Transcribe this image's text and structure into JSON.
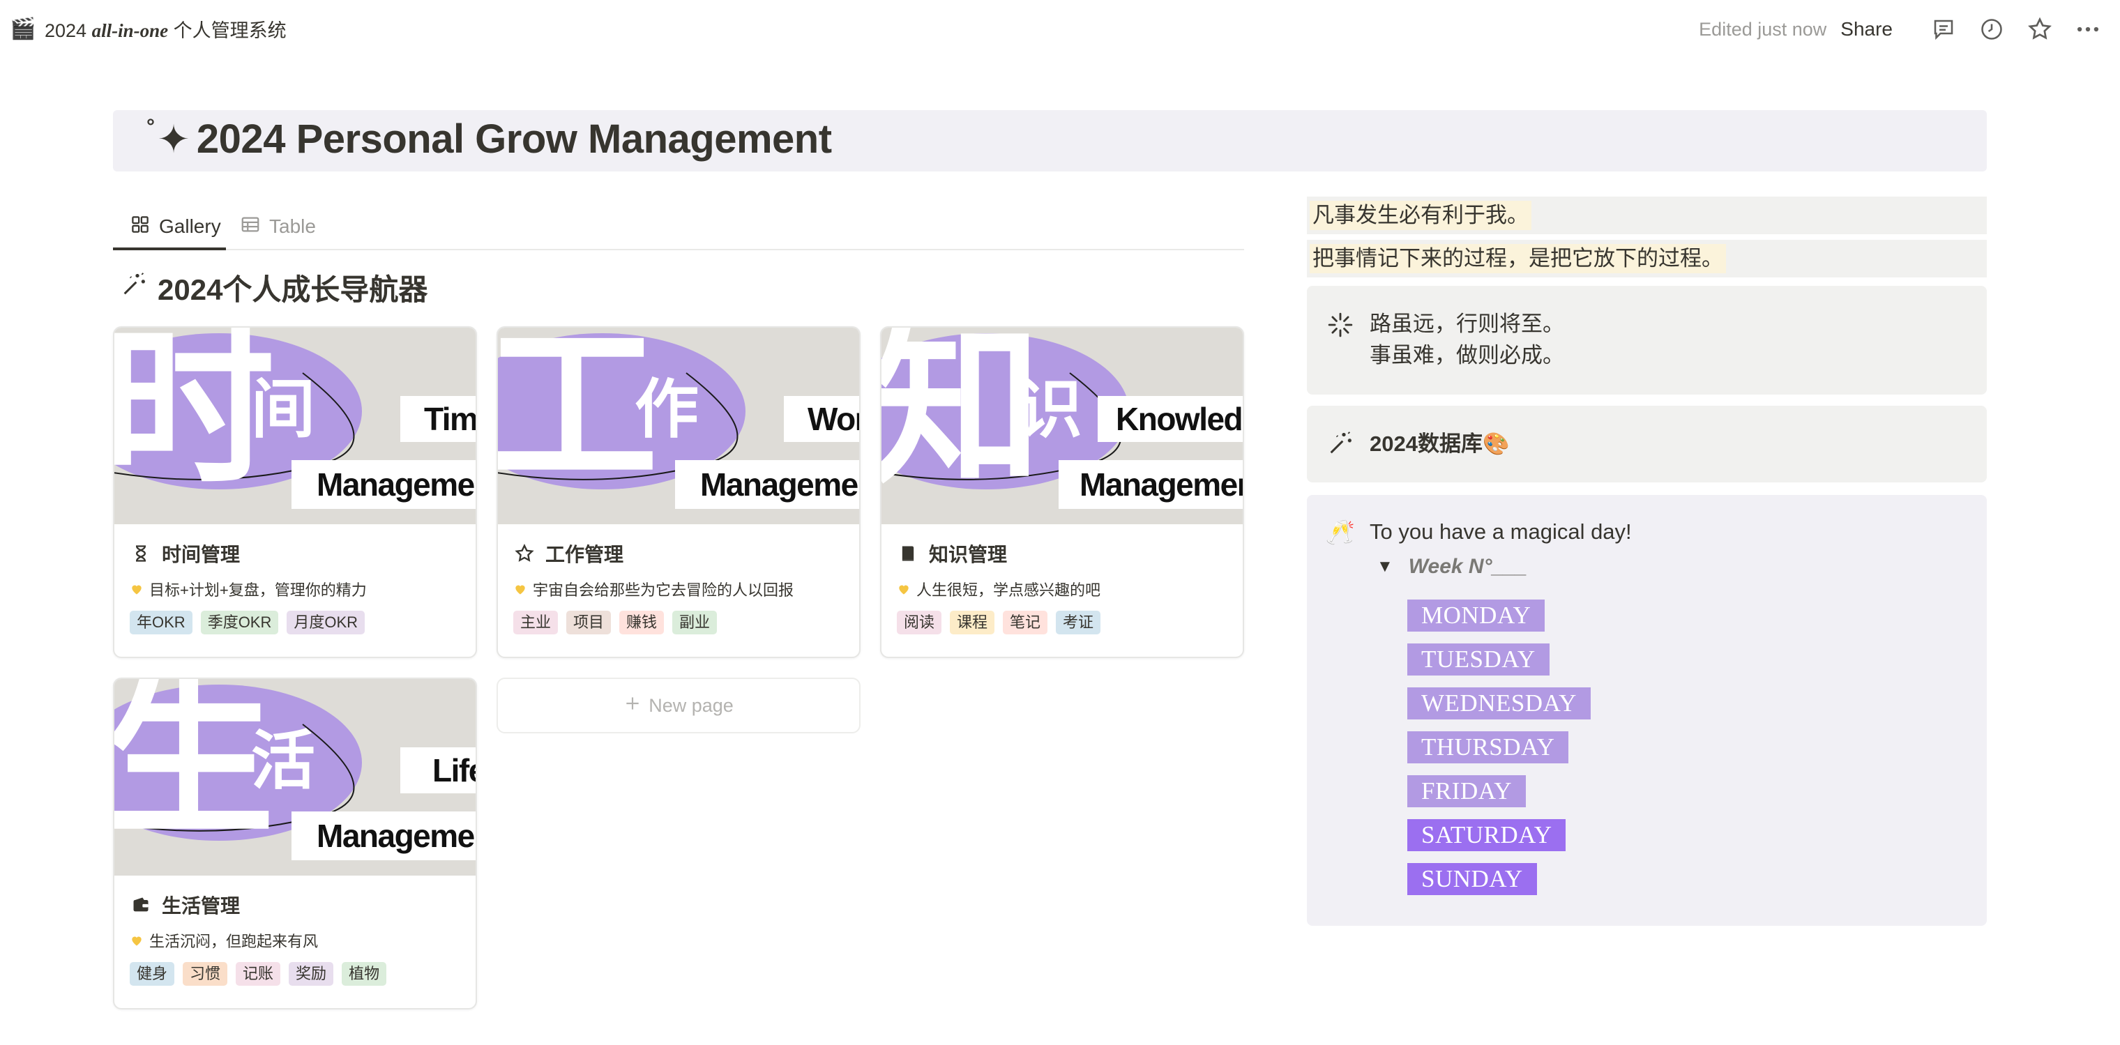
{
  "topbar": {
    "page_icon": "clapperboard-icon",
    "title_prefix": "2024 ",
    "title_italic": "all-in-one",
    "title_suffix": " 个人管理系统",
    "edited": "Edited just now",
    "share": "Share"
  },
  "page": {
    "title_degree": "°",
    "title_sparkle": "✦",
    "title": "2024 Personal Grow Management"
  },
  "tabs": [
    {
      "label": "Gallery",
      "icon": "gallery-icon"
    },
    {
      "label": "Table",
      "icon": "table-icon"
    }
  ],
  "section_title": "2024个人成长导航器",
  "cards": [
    {
      "big": "时",
      "small": "间",
      "line1": "Time",
      "line2": "Management",
      "name": "时间管理",
      "icon": "hourglass-icon",
      "desc": "目标+计划+复盘，管理你的精力",
      "tags": [
        {
          "label": "年OKR",
          "color": "#d3e5ef"
        },
        {
          "label": "季度OKR",
          "color": "#dbeddb"
        },
        {
          "label": "月度OKR",
          "color": "#e8deee"
        }
      ]
    },
    {
      "big": "工",
      "small": "作",
      "line1": "Work",
      "line2": "Management",
      "name": "工作管理",
      "icon": "star-icon",
      "desc": "宇宙自会给那些为它去冒险的人以回报",
      "tags": [
        {
          "label": "主业",
          "color": "#f5e0e9"
        },
        {
          "label": "项目",
          "color": "#eee0da"
        },
        {
          "label": "赚钱",
          "color": "#ffe2dd"
        },
        {
          "label": "副业",
          "color": "#dbeddb"
        }
      ]
    },
    {
      "big": "知",
      "small": "识",
      "line1": "Knowledge",
      "line2": "Management",
      "name": "知识管理",
      "icon": "book-icon",
      "desc": "人生很短，学点感兴趣的吧",
      "tags": [
        {
          "label": "阅读",
          "color": "#f5e0e9"
        },
        {
          "label": "课程",
          "color": "#fdecc8"
        },
        {
          "label": "笔记",
          "color": "#ffe2dd"
        },
        {
          "label": "考证",
          "color": "#d3e5ef"
        }
      ]
    },
    {
      "big": "生",
      "small": "活",
      "line1": "Life",
      "line2": "Management",
      "name": "生活管理",
      "icon": "wallet-icon",
      "desc": "生活沉闷，但跑起来有风",
      "tags": [
        {
          "label": "健身",
          "color": "#d3e5ef"
        },
        {
          "label": "习惯",
          "color": "#fadec9"
        },
        {
          "label": "记账",
          "color": "#f5e0e9"
        },
        {
          "label": "奖励",
          "color": "#e8deee"
        },
        {
          "label": "植物",
          "color": "#dbeddb"
        }
      ]
    }
  ],
  "new_page": "New page",
  "quotes": [
    "凡事发生必有利于我。",
    "把事情记下来的过程，是把它放下的过程。"
  ],
  "callout_motto": {
    "line1": "路虽远，行则将至。",
    "line2": "事虽难，做则必成。"
  },
  "callout_database": {
    "label": "2024数据库🎨"
  },
  "callout_week": {
    "greeting": "To you have a magical day!",
    "toggle": "Week N°___",
    "days": [
      {
        "label": "MONDAY",
        "color": "#b29ae3"
      },
      {
        "label": "TUESDAY",
        "color": "#b29ae3"
      },
      {
        "label": "WEDNESDAY",
        "color": "#b29ae3"
      },
      {
        "label": "THURSDAY",
        "color": "#b29ae3"
      },
      {
        "label": "FRIDAY",
        "color": "#b29ae3"
      },
      {
        "label": "SATURDAY",
        "color": "#9b6ff0"
      },
      {
        "label": "SUNDAY",
        "color": "#9b6ff0"
      }
    ]
  }
}
